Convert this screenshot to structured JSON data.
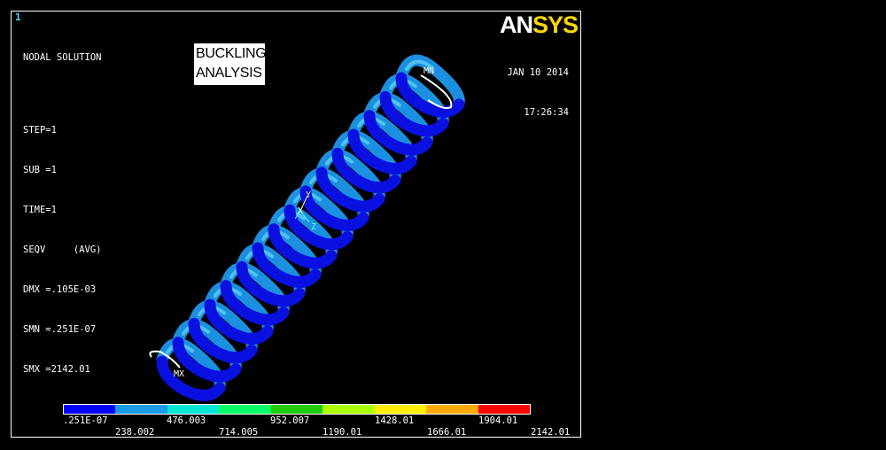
{
  "window_number": "1",
  "info": {
    "lines": [
      "NODAL SOLUTION",
      "STEP=1",
      "SUB =1",
      "TIME=1",
      "SEQV     (AVG)",
      "DMX =.105E-03",
      "SMN =.251E-07",
      "SMX =2142.01"
    ]
  },
  "title_box": {
    "line1": "BUCKLING",
    "line2": "ANALYSIS"
  },
  "logo": {
    "an": "AN",
    "sys": "SYS"
  },
  "timestamp": {
    "date": "JAN 10 2014",
    "time": "17:26:34"
  },
  "markers": {
    "min": "MN",
    "max": "MX"
  },
  "triad": {
    "x": "X",
    "y": "Y",
    "z": "Z"
  },
  "legend": {
    "colors": [
      "#0000ff",
      "#1a9be8",
      "#00e6d6",
      "#00ff66",
      "#22cc00",
      "#aaff00",
      "#ffee00",
      "#ffaa00",
      "#ff0000"
    ],
    "top_labels": [
      ".251E-07",
      "476.003",
      "952.007",
      "1428.01",
      "1904.01"
    ],
    "bottom_labels": [
      "238.002",
      "714.005",
      "1190.01",
      "1666.01",
      "2142.01"
    ]
  }
}
